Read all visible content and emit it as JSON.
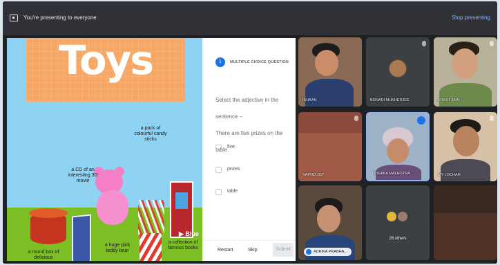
{
  "banner": {
    "presenting_text": "You're presenting to everyone",
    "stop_label": "Stop presenting",
    "icon": "present-to-all-icon"
  },
  "slide": {
    "big_title": "Toys",
    "labels": {
      "round_box": "a round box of delicious chocolates",
      "cd": "a CD of an interesting 3D movie",
      "teddy": "a huge pink teddy bear",
      "candy": "a pack of colourful candy sticks",
      "books": "a collection of famous books"
    },
    "brand": "▶ Blue"
  },
  "quiz": {
    "number": "1",
    "type": "MULTIPLE CHOICE QUESTION",
    "prompt_lines": [
      "Select the adjective in the sentence –",
      "There are five prizes on the table."
    ],
    "options": [
      "five",
      "prizes",
      "table"
    ],
    "restart": "Restart",
    "skip": "Skip",
    "submit": "Submit"
  },
  "participants": [
    {
      "name": "ISHAAN"
    },
    {
      "name": "BONADI MUKHERJEE"
    },
    {
      "name": "RISHIT JAIN"
    },
    {
      "name": "SAPNO JOY"
    },
    {
      "name": "TOSHIKA MALHOTRA"
    },
    {
      "name": "MY LOCHAN"
    },
    {
      "name": "ADRIKA PRABHA..."
    },
    {
      "name": "26 others"
    },
    {
      "name": ""
    }
  ],
  "colors": {
    "accent": "#1a73e8",
    "panel_bg": "#202124",
    "tile_bg": "#3c4043",
    "grass": "#7cbf25",
    "sky": "#8fd3f2"
  }
}
